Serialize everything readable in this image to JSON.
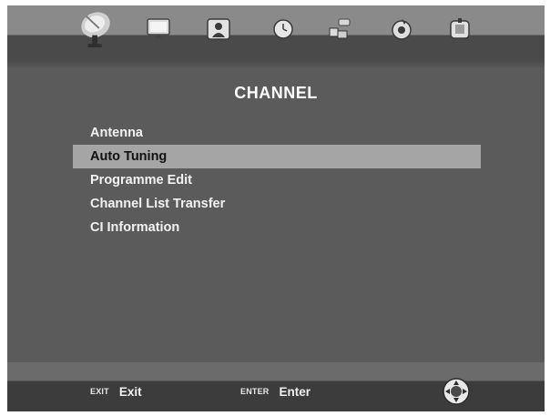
{
  "top_icons": [
    {
      "name": "satellite-dish-icon",
      "selected": true
    },
    {
      "name": "monitor-icon",
      "selected": false
    },
    {
      "name": "speaker-icon",
      "selected": false
    },
    {
      "name": "clock-icon",
      "selected": false
    },
    {
      "name": "lock-icon",
      "selected": false
    },
    {
      "name": "settings-disc-icon",
      "selected": false
    },
    {
      "name": "usb-media-icon",
      "selected": false
    }
  ],
  "page_title": "CHANNEL",
  "menu": {
    "items": [
      {
        "label": "Antenna",
        "selected": false
      },
      {
        "label": "Auto Tuning",
        "selected": true
      },
      {
        "label": "Programme Edit",
        "selected": false
      },
      {
        "label": "Channel List Transfer",
        "selected": false
      },
      {
        "label": "CI Information",
        "selected": false
      }
    ]
  },
  "footer": {
    "exit_key": "EXIT",
    "exit_label": "Exit",
    "enter_key": "ENTER",
    "enter_label": "Enter",
    "nav_icon": "navigation-pad-icon"
  },
  "colors": {
    "background": "#5b5b5b",
    "highlight": "#a5a5a5",
    "text": "#f2f2f2"
  }
}
